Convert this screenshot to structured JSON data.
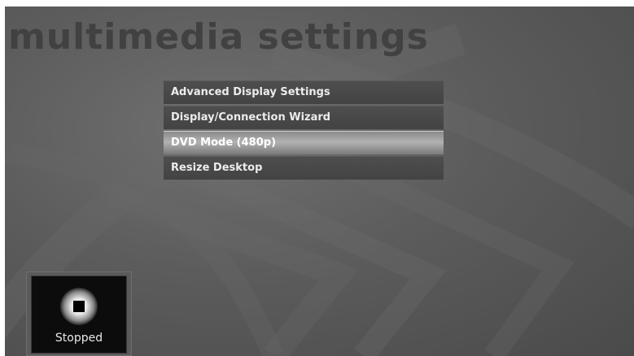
{
  "page": {
    "title": "multimedia settings"
  },
  "menu": {
    "items": [
      {
        "label": "Advanced Display Settings",
        "selected": false
      },
      {
        "label": "Display/Connection Wizard",
        "selected": false
      },
      {
        "label": "DVD Mode (480p)",
        "selected": true
      },
      {
        "label": "Resize Desktop",
        "selected": false
      }
    ]
  },
  "player": {
    "status": "Stopped",
    "icon": "stop-icon"
  },
  "colors": {
    "background": "#5c5c5c",
    "title": "#414141",
    "menu_item": "#474747",
    "menu_selected": "#a0a0a0",
    "menu_text": "#ececec"
  }
}
